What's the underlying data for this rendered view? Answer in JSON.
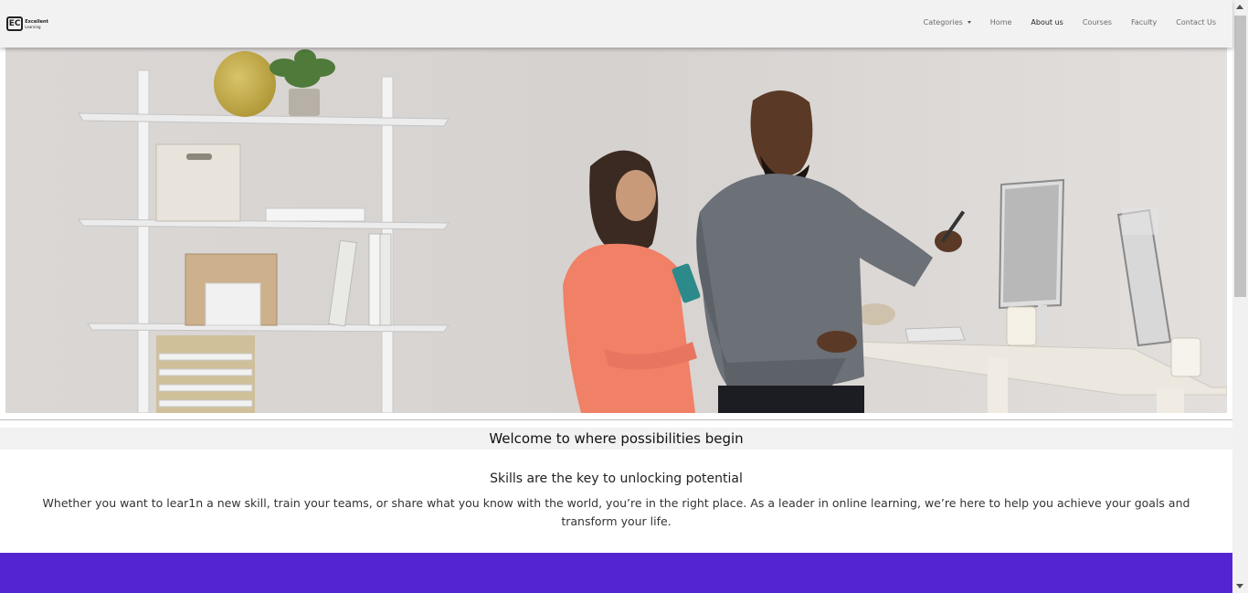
{
  "brand": {
    "mark": "EC",
    "name": "Excellent",
    "tagline": "Learning"
  },
  "nav": {
    "items": [
      {
        "label": "Categories",
        "dropdown": true
      },
      {
        "label": "Home"
      },
      {
        "label": "About us",
        "active": true
      },
      {
        "label": "Courses"
      },
      {
        "label": "Faculty"
      },
      {
        "label": "Contact Us"
      }
    ]
  },
  "content": {
    "welcome": "Welcome to where possibilities begin",
    "subheading": "Skills are the key to unlocking potential",
    "paragraph": "Whether you want to lear1n a new skill, train your teams, or share what you know with the world, you’re in the right place. As a leader in online learning, we’re here to help you achieve your goals and transform your life."
  },
  "colors": {
    "navbar": "#f2f2f2",
    "accent_band": "#5524d2"
  }
}
